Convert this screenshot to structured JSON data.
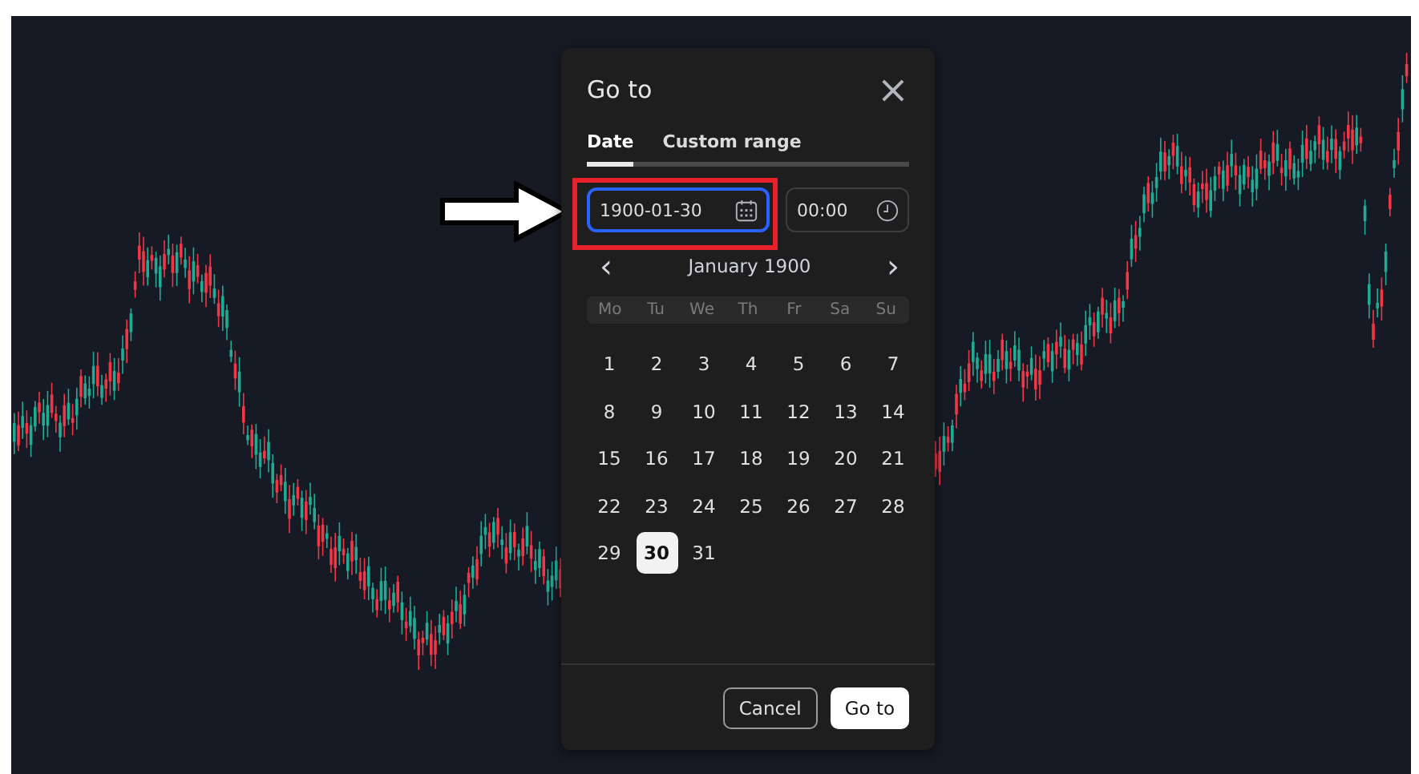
{
  "dialog": {
    "title": "Go to",
    "close": "×",
    "tabs": [
      {
        "label": "Date",
        "selected": true
      },
      {
        "label": "Custom range",
        "selected": false
      }
    ],
    "date_field": {
      "value": "1900-01-30",
      "focused": true
    },
    "time_field": {
      "value": "00:00",
      "focused": false
    },
    "calendar": {
      "month": "January 1900",
      "prev": "‹",
      "next": "›",
      "weekdays": [
        "Mo",
        "Tu",
        "We",
        "Th",
        "Fr",
        "Sa",
        "Su"
      ],
      "days": [
        {
          "label": "1",
          "selected": false
        },
        {
          "label": "2",
          "selected": false
        },
        {
          "label": "3",
          "selected": false
        },
        {
          "label": "4",
          "selected": false
        },
        {
          "label": "5",
          "selected": false
        },
        {
          "label": "6",
          "selected": false
        },
        {
          "label": "7",
          "selected": false
        },
        {
          "label": "8",
          "selected": false
        },
        {
          "label": "9",
          "selected": false
        },
        {
          "label": "10",
          "selected": false
        },
        {
          "label": "11",
          "selected": false
        },
        {
          "label": "12",
          "selected": false
        },
        {
          "label": "13",
          "selected": false
        },
        {
          "label": "14",
          "selected": false
        },
        {
          "label": "15",
          "selected": false
        },
        {
          "label": "16",
          "selected": false
        },
        {
          "label": "17",
          "selected": false
        },
        {
          "label": "18",
          "selected": false
        },
        {
          "label": "19",
          "selected": false
        },
        {
          "label": "20",
          "selected": false
        },
        {
          "label": "21",
          "selected": false
        },
        {
          "label": "22",
          "selected": false
        },
        {
          "label": "23",
          "selected": false
        },
        {
          "label": "24",
          "selected": false
        },
        {
          "label": "25",
          "selected": false
        },
        {
          "label": "26",
          "selected": false
        },
        {
          "label": "27",
          "selected": false
        },
        {
          "label": "28",
          "selected": false
        },
        {
          "label": "29",
          "selected": false
        },
        {
          "label": "30",
          "selected": true
        },
        {
          "label": "31",
          "selected": false
        }
      ]
    },
    "buttons": [
      {
        "label": "Cancel",
        "kind": "secondary"
      },
      {
        "label": "Go to",
        "kind": "primary"
      }
    ]
  }
}
